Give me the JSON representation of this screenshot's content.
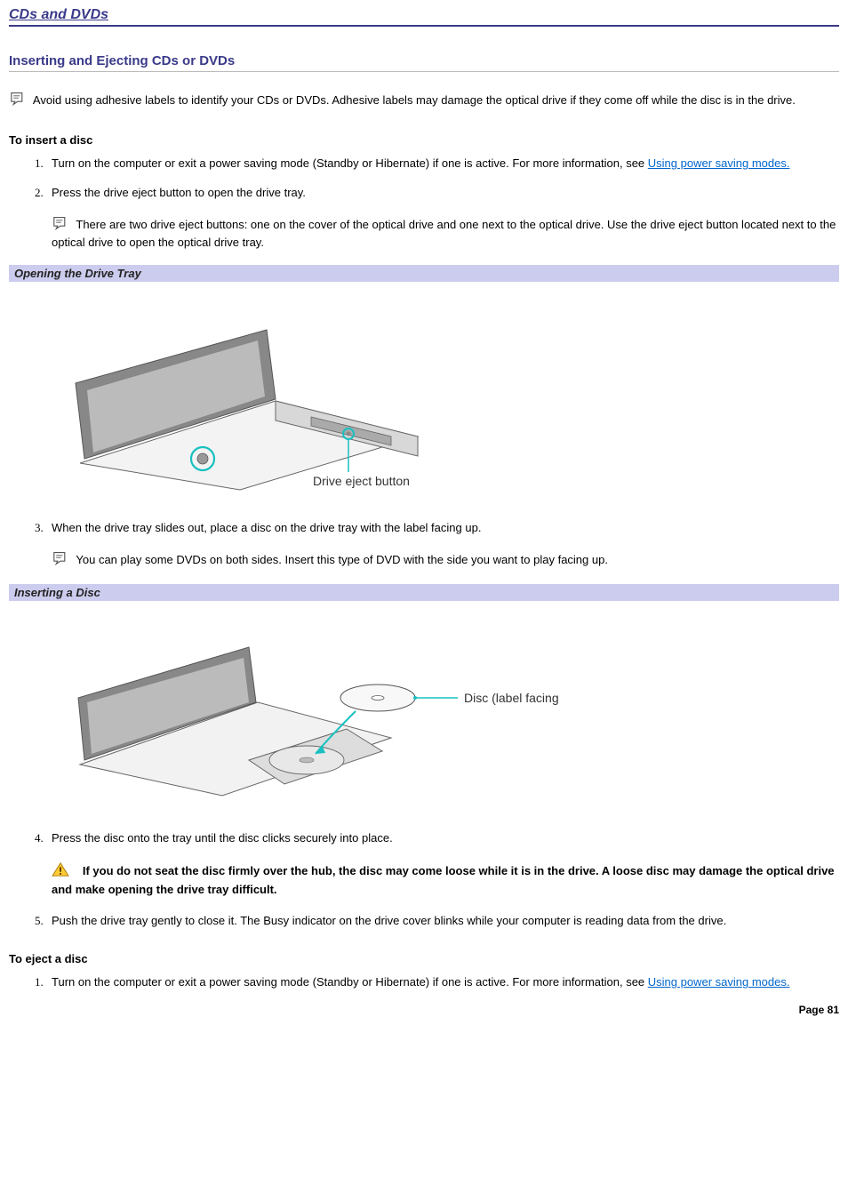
{
  "page_title": "CDs and DVDs",
  "section_title": "Inserting and Ejecting CDs or DVDs",
  "intro_note": "Avoid using adhesive labels to identify your CDs or DVDs. Adhesive labels may damage the optical drive if they come off while the disc is in the drive.",
  "insert": {
    "heading": "To insert a disc",
    "steps": {
      "s1_a": "Turn on the computer or exit a power saving mode (Standby or Hibernate) if one is active. For more information, see ",
      "s1_link": "Using power saving modes.",
      "s2": "Press the drive eject button to open the drive tray.",
      "s2_note": "There are two drive eject buttons: one on the cover of the optical drive and one next to the optical drive. Use the drive eject button located next to the optical drive to open the optical drive tray.",
      "s3": "When the drive tray slides out, place a disc on the drive tray with the label facing up.",
      "s3_note": "You can play some DVDs on both sides. Insert this type of DVD with the side you want to play facing up.",
      "s4": "Press the disc onto the tray until the disc clicks securely into place.",
      "s4_warn": "If you do not seat the disc firmly over the hub, the disc may come loose while it is in the drive. A loose disc may damage the optical drive and make opening the drive tray difficult.",
      "s5": "Push the drive tray gently to close it. The Busy indicator on the drive cover blinks while your computer is reading data from the drive."
    }
  },
  "fig1": {
    "heading": "Opening the Drive Tray",
    "label": "Drive eject button"
  },
  "fig2": {
    "heading": "Inserting a Disc",
    "label": "Disc (label facing up)"
  },
  "eject": {
    "heading": "To eject a disc",
    "steps": {
      "s1_a": "Turn on the computer or exit a power saving mode (Standby or Hibernate) if one is active. For more information, see ",
      "s1_link": "Using power saving modes."
    }
  },
  "page_number": "Page 81"
}
